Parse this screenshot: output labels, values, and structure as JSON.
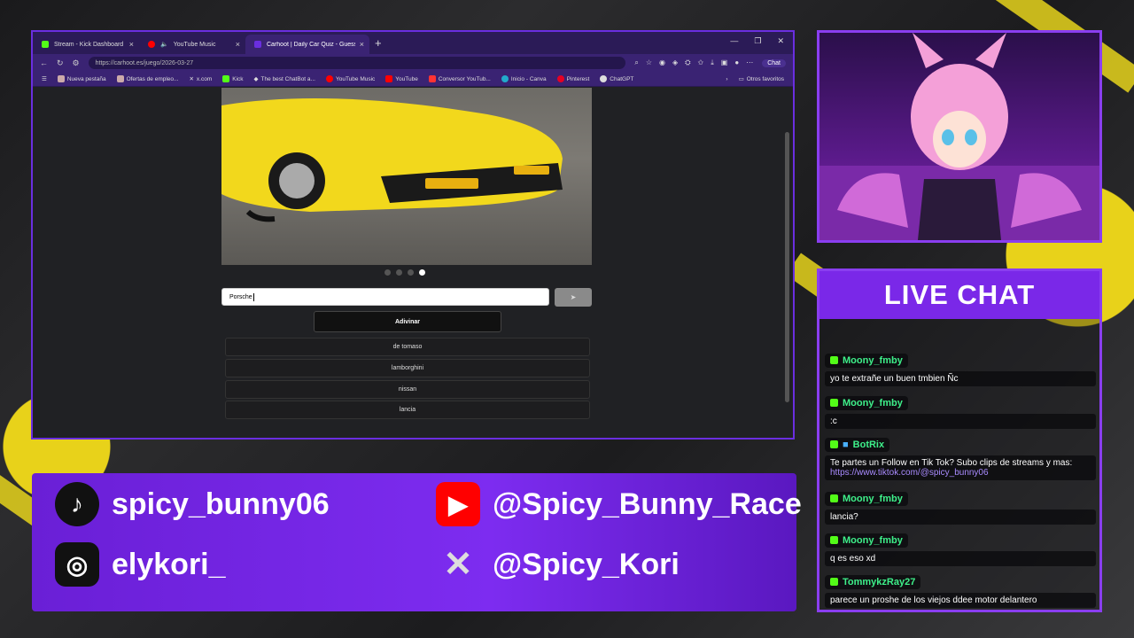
{
  "browser": {
    "tabs": [
      {
        "label": "Stream - Kick Dashboard",
        "color": "#53fc18"
      },
      {
        "label": "YouTube Music",
        "color": "#ff0000"
      },
      {
        "label": "Carhoot | Daily Car Quiz - Guess th",
        "color": "#6a2ee0"
      }
    ],
    "url": "https://carhoot.es/juego/2026-03-27",
    "chat_label": "Chat",
    "bookmarks": [
      "Nueva pestaña",
      "Ofertas de empleo...",
      "x.com",
      "Kick",
      "The best ChatBot a...",
      "YouTube Music",
      "YouTube",
      "Conversor YouTub...",
      "Inicio - Canva",
      "Pinterest",
      "ChatGPT"
    ],
    "other_bookmarks": "Otros favoritos"
  },
  "quiz": {
    "guess_value": "Porsche",
    "submit_label": "Adivinar",
    "suggestions": [
      "de tomaso",
      "lamborghini",
      "nissan",
      "lancia"
    ],
    "image_count": 4,
    "active_image": 4
  },
  "socials": {
    "tiktok": "spicy_bunny06",
    "youtube": "@Spicy_Bunny_Race",
    "instagram": "elykori_",
    "x": "@Spicy_Kori"
  },
  "chat": {
    "title": "LIVE CHAT",
    "messages": [
      {
        "user": "Moony_fmby",
        "text": "yo te extrañe un buen tmbien Ñc"
      },
      {
        "user": "Moony_fmby",
        "text": ":c"
      },
      {
        "user": "BotRix",
        "text": "Te partes un Follow en Tik Tok? Subo clips de streams y mas: ",
        "link": "https://www.tiktok.com/@spicy_bunny06"
      },
      {
        "user": "Moony_fmby",
        "text": "lancia?"
      },
      {
        "user": "Moony_fmby",
        "text": "q es eso xd"
      },
      {
        "user": "TommykzRay27",
        "text": "parece un proshe de los viejos ddee motor delantero"
      }
    ]
  }
}
